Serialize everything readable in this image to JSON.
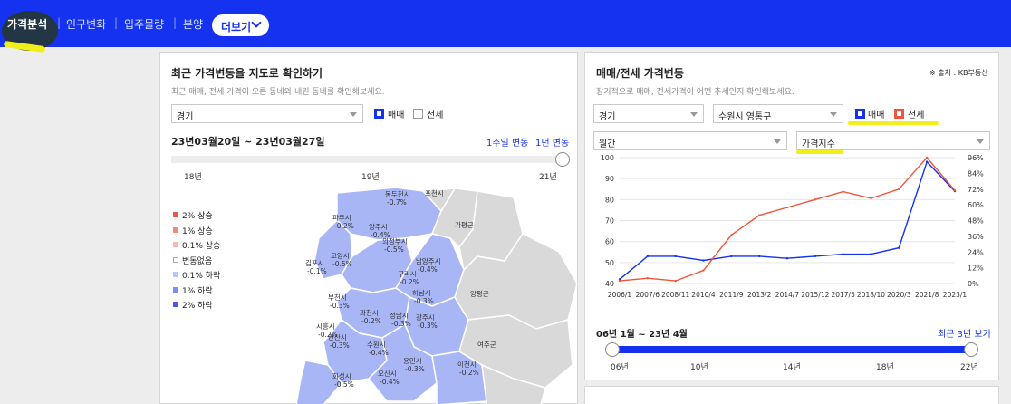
{
  "nav": {
    "tabs": [
      "가격분석",
      "인구변화",
      "입주물량",
      "분양"
    ],
    "more_label": "더보기"
  },
  "map_panel": {
    "title": "최근 가격변동을 지도로 확인하기",
    "subtitle": "최근 매매, 전세 가격이 오른 동네와 내린 동네를 확인해보세요.",
    "region_select": "경기",
    "check_sale": "매매",
    "check_jeonse": "전세",
    "date_range": "23년03월20일 ~ 23년03월27일",
    "link_week": "1주일 변동",
    "link_year": "1년 변동",
    "slider_ticks": [
      "18년",
      "19년",
      "21년"
    ],
    "legend": [
      {
        "label": "2% 상승",
        "color": "#e8594a"
      },
      {
        "label": "1% 상승",
        "color": "#f08a7b"
      },
      {
        "label": "0.1% 상승",
        "color": "#f6b9b0"
      },
      {
        "label": "변동없음",
        "color": "#ffffff"
      },
      {
        "label": "0.1% 하락",
        "color": "#b9c4f7"
      },
      {
        "label": "1% 하락",
        "color": "#7a8ff2"
      },
      {
        "label": "2% 하락",
        "color": "#4658ef"
      }
    ],
    "regions": [
      {
        "name": "동두천시",
        "value": "-0.7%"
      },
      {
        "name": "포천시",
        "value": ""
      },
      {
        "name": "파주시",
        "value": "-0.2%"
      },
      {
        "name": "양주시",
        "value": "-0.4%"
      },
      {
        "name": "가평군",
        "value": ""
      },
      {
        "name": "의정부시",
        "value": "-0.5%"
      },
      {
        "name": "고양시",
        "value": "-0.5%"
      },
      {
        "name": "김포시",
        "value": "-0.1%"
      },
      {
        "name": "남양주시",
        "value": "-0.4%"
      },
      {
        "name": "구리시",
        "value": "-0.2%"
      },
      {
        "name": "하남시",
        "value": "-0.3%"
      },
      {
        "name": "양평군",
        "value": ""
      },
      {
        "name": "부천시",
        "value": "-0.3%"
      },
      {
        "name": "과천시",
        "value": "-0.2%"
      },
      {
        "name": "성남시",
        "value": "-0.3%"
      },
      {
        "name": "광주시",
        "value": "-0.3%"
      },
      {
        "name": "시흥시",
        "value": "-0.2%"
      },
      {
        "name": "안산시",
        "value": "-0.3%"
      },
      {
        "name": "수원시",
        "value": "-0.4%"
      },
      {
        "name": "여주군",
        "value": ""
      },
      {
        "name": "용인시",
        "value": "-0.3%"
      },
      {
        "name": "이천시",
        "value": "-0.2%"
      },
      {
        "name": "화성시",
        "value": "-0.5%"
      },
      {
        "name": "오산시",
        "value": "-0.4%"
      }
    ]
  },
  "price_panel": {
    "title": "매매/전세 가격변동",
    "source": "※ 출처 : KB부동산",
    "subtitle": "장기적으로 매매, 전세가격이 어떤 추세인지 확인해보세요.",
    "select_region": "경기",
    "select_district": "수원시 영통구",
    "check_sale": "매매",
    "check_jeonse": "전세",
    "select_period": "월간",
    "select_metric": "가격지수",
    "period_range": "06년 1월 ~ 23년 4월",
    "recent_link": "최근 3년 보기",
    "slider_ticks": [
      "06년",
      "10년",
      "14년",
      "18년",
      "22년"
    ],
    "colors": {
      "sale": "#1432f0",
      "jeonse": "#f0553a"
    }
  },
  "chart_data": {
    "type": "line",
    "x": [
      "2006/1",
      "2007/6",
      "2008/11",
      "2010/4",
      "2011/9",
      "2013/2",
      "2014/7",
      "2015/12",
      "2017/5",
      "2018/10",
      "2020/3",
      "2021/8",
      "2023/1"
    ],
    "series": [
      {
        "name": "매매",
        "axis": "left",
        "values": [
          42,
          53,
          53,
          51,
          53,
          53,
          52,
          53,
          54,
          54,
          57,
          98,
          84
        ]
      },
      {
        "name": "전세",
        "axis": "right",
        "values": [
          2,
          4,
          2,
          10,
          37,
          52,
          58,
          64,
          70,
          65,
          72,
          96,
          71
        ]
      }
    ],
    "ylim_left": [
      40,
      100
    ],
    "yticks_left": [
      "40",
      "50",
      "60",
      "70",
      "80",
      "90",
      "100"
    ],
    "ylim_right": [
      0,
      96
    ],
    "yticks_right": [
      "0%",
      "12%",
      "24%",
      "36%",
      "48%",
      "60%",
      "72%",
      "84%",
      "96%"
    ],
    "grid": true,
    "legend": "top-right"
  }
}
